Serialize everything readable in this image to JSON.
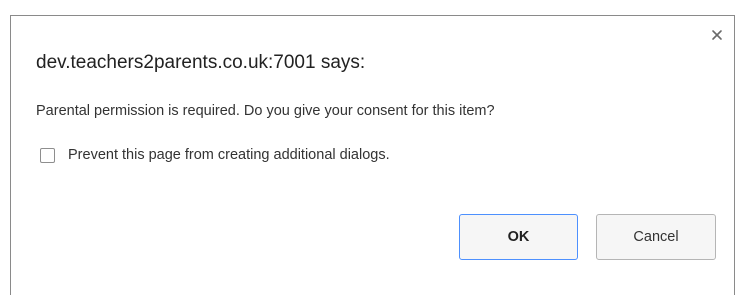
{
  "dialog": {
    "title": "dev.teachers2parents.co.uk:7001 says:",
    "message": "Parental permission is required. Do you give your consent for this item?",
    "prevent_label": "Prevent this page from creating additional dialogs.",
    "prevent_checked": false,
    "close_icon": "close-icon",
    "ok_label": "OK",
    "cancel_label": "Cancel",
    "colors": {
      "ok_border": "#4d90fe",
      "button_bg": "#f6f6f6",
      "text": "#333333"
    }
  }
}
